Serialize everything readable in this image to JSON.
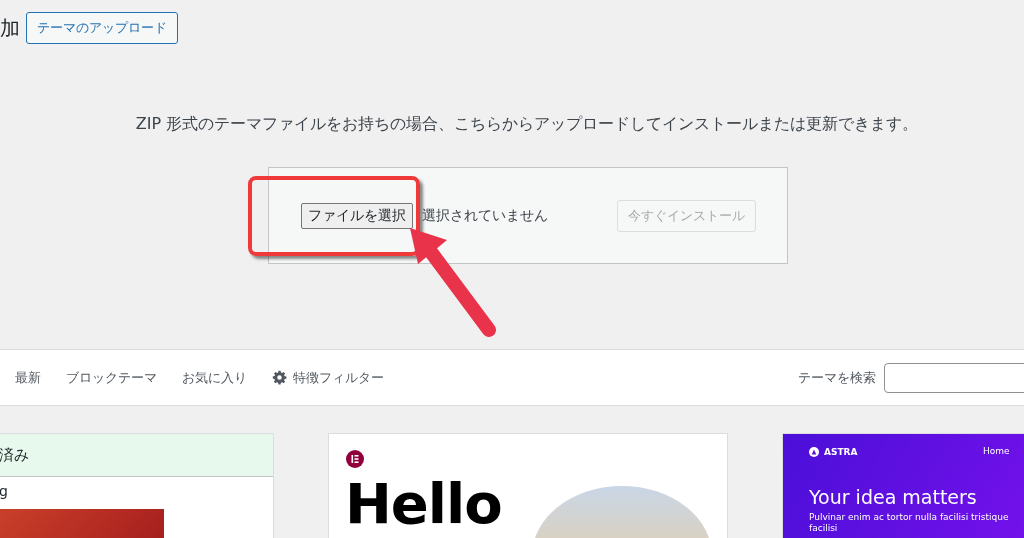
{
  "header": {
    "title": "加",
    "upload_button": "テーマのアップロード"
  },
  "description": "ZIP 形式のテーマファイルをお持ちの場合、こちらからアップロードしてインストールまたは更新できます。",
  "upload_form": {
    "file_button": "ファイルを選択",
    "file_status": "選択されていません",
    "install_button": {
      "label": "今すぐインストール",
      "disabled": true
    }
  },
  "filter_bar": {
    "items": [
      {
        "kind": "link",
        "label": "最新"
      },
      {
        "kind": "link",
        "label": "ブロックテーマ"
      },
      {
        "kind": "link",
        "label": "お気に入り"
      },
      {
        "kind": "filter",
        "label": "特徴フィルター"
      }
    ],
    "search_label": "テーマを検索"
  },
  "themes": [
    {
      "kind": "installed",
      "status": "済み",
      "name": "g"
    },
    {
      "kind": "hello",
      "headline": "Hello"
    },
    {
      "kind": "astra",
      "logo": "ASTRA",
      "nav": [
        "Home"
      ],
      "headline": "Your idea matters",
      "body": "Pulvinar enim ac tortor nulla facilisi tristique facilisi"
    }
  ]
}
